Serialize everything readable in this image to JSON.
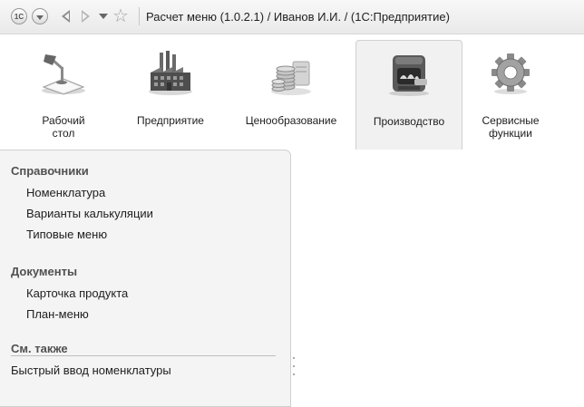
{
  "window": {
    "title": "Расчет меню (1.0.2.1) / Иванов И.И. / (1С:Предприятие)",
    "logo_text": "1С",
    "icons": {
      "logo": "1c-logo-icon",
      "menu": "main-menu-icon",
      "back": "back-arrow-icon",
      "forward": "forward-arrow-icon",
      "history": "history-dropdown-icon",
      "favorites": "star-icon"
    }
  },
  "sections": [
    {
      "label": "Рабочий\nстол",
      "icon": "desk-lamp-icon",
      "active": false
    },
    {
      "label": "Предприятие",
      "icon": "factory-icon",
      "active": false
    },
    {
      "label": "Ценообразование",
      "icon": "coins-icon",
      "active": false
    },
    {
      "label": "Производство",
      "icon": "oven-icon",
      "active": true
    },
    {
      "label": "Сервисные\nфункции",
      "icon": "gear-icon",
      "active": false
    }
  ],
  "nav": {
    "groups": [
      {
        "title": "Справочники",
        "items": [
          "Номенклатура",
          "Варианты калькуляции",
          "Типовые меню"
        ]
      },
      {
        "title": "Документы",
        "items": [
          "Карточка продукта",
          "План-меню"
        ]
      }
    ],
    "see_also": {
      "title": "См. также",
      "items": [
        "Быстрый ввод номенклатуры"
      ]
    }
  }
}
